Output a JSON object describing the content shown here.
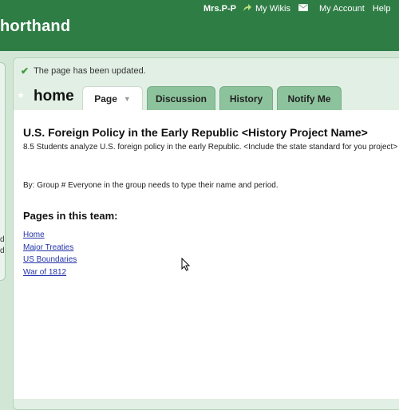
{
  "header": {
    "site_title": "horthand",
    "user": "Mrs.P-P",
    "my_wikis": "My Wikis",
    "my_account": "My Account",
    "help": "Help",
    "brand_color": "#2e7d45"
  },
  "notice": {
    "text": "The page has been updated."
  },
  "page": {
    "name": "home",
    "tabs": [
      {
        "label": "Page",
        "active": true
      },
      {
        "label": "Discussion"
      },
      {
        "label": "History"
      },
      {
        "label": "Notify Me"
      }
    ]
  },
  "sidebar": {
    "line1": "d",
    "line2": "d"
  },
  "content": {
    "title": "U.S. Foreign Policy in the Early Republic <History Project Name>",
    "standard": "8.5 Students analyze U.S. foreign policy in the early Republic. <Include the state standard for you project>",
    "by": "By: Group # Everyone in the group needs to type their name and period.",
    "pages_heading": "Pages in this team:",
    "links": [
      "Home",
      "Major Treaties",
      "US Boundaries",
      "War of 1812"
    ]
  }
}
